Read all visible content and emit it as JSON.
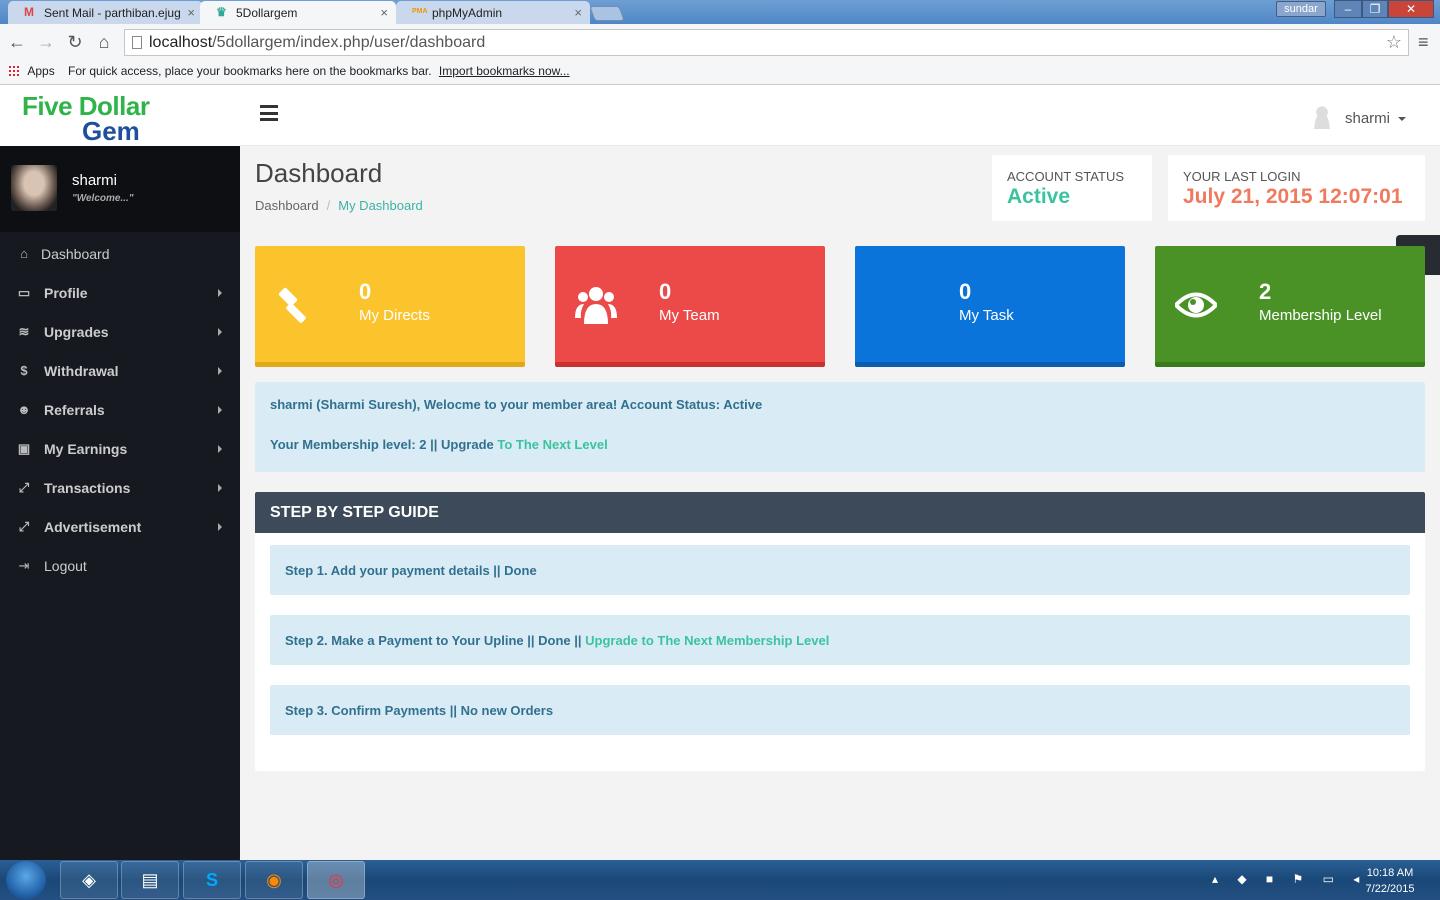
{
  "browser": {
    "tabs": [
      {
        "icon": "M",
        "title": "Sent Mail - parthiban.ejug",
        "close": "×"
      },
      {
        "icon": "♛",
        "title": "5Dollargem",
        "close": "×"
      },
      {
        "icon": "PMA",
        "title": "phpMyAdmin",
        "close": "×"
      }
    ],
    "window_user": "sundar",
    "url_host": "localhost",
    "url_path": "/5dollargem/index.php/user/dashboard",
    "bookmarks": {
      "apps": "Apps",
      "hint": "For quick access, place your bookmarks here on the bookmarks bar.",
      "import_link": "Import bookmarks now..."
    }
  },
  "logo": {
    "line1": "Five Dollar",
    "line2": "Gem"
  },
  "topbar": {
    "username": "sharmi"
  },
  "sidebar": {
    "profile_name": "sharmi",
    "profile_tagline": "\"Welcome...\"",
    "items": [
      {
        "label": "Dashboard",
        "icon": "home-icon",
        "glyph": "⌂"
      },
      {
        "label": "Profile",
        "icon": "laptop-icon",
        "glyph": "▭"
      },
      {
        "label": "Upgrades",
        "icon": "database-icon",
        "glyph": "≋"
      },
      {
        "label": "Withdrawal",
        "icon": "dollar-icon",
        "glyph": "$"
      },
      {
        "label": "Referrals",
        "icon": "users-icon",
        "glyph": "☻"
      },
      {
        "label": "My Earnings",
        "icon": "money-icon",
        "glyph": "▣"
      },
      {
        "label": "Transactions",
        "icon": "expand-icon",
        "glyph": "⤢"
      },
      {
        "label": "Advertisement",
        "icon": "expand-icon",
        "glyph": "⤢"
      },
      {
        "label": "Logout",
        "icon": "sign-out-icon",
        "glyph": "⇥"
      }
    ]
  },
  "header": {
    "title": "Dashboard",
    "breadcrumb": [
      "Dashboard",
      "/",
      "My Dashboard"
    ],
    "account_status_label": "ACCOUNT STATUS",
    "account_status_value": "Active",
    "last_login_label": "YOUR LAST LOGIN",
    "last_login_value": "July 21, 2015 12:07:01"
  },
  "cards": [
    {
      "value": "0",
      "label": "My Directs",
      "color": "#fcc42c",
      "icon": "gavel-icon"
    },
    {
      "value": "0",
      "label": "My Team",
      "color": "#ec4949",
      "icon": "users-icon"
    },
    {
      "value": "0",
      "label": "My Task",
      "color": "#0a74da",
      "icon": "tasks-icon"
    },
    {
      "value": "2",
      "label": "Membership Level",
      "color": "#4a9226",
      "icon": "eye-icon"
    }
  ],
  "welcome": {
    "line1": "sharmi (Sharmi Suresh), Welocme to your member area! Account Status: Active",
    "line2_prefix": "Your Membership level: 2 || Upgrade",
    "line2_link": "To The Next Level"
  },
  "guide": {
    "title": "STEP BY STEP GUIDE",
    "steps": [
      {
        "text": "Step 1. Add your payment details || Done",
        "link": ""
      },
      {
        "text": "Step 2. Make a Payment to Your Upline || Done ||",
        "link": "Upgrade to The Next Membership Level"
      },
      {
        "text": "Step 3. Confirm Payments || No new Orders",
        "link": ""
      }
    ]
  },
  "taskbar": {
    "time": "10:18 AM",
    "date": "7/22/2015"
  }
}
